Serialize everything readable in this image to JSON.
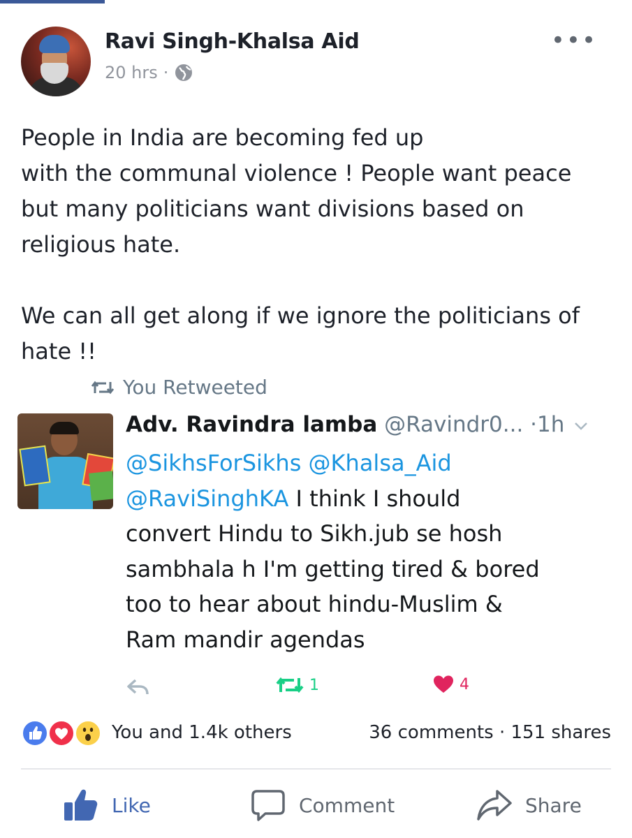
{
  "post": {
    "author": "Ravi Singh-Khalsa Aid",
    "time": "20 hrs",
    "separator": "·",
    "more_label": "•••",
    "text_lines": [
      "People in India are becoming fed up",
      "with the communal violence ! People want peace",
      "but many politicians want divisions based on",
      "religious hate."
    ],
    "text_lines_2": [
      "We can all get along if we ignore the politicians of",
      "hate !!"
    ]
  },
  "retweet": {
    "label": "You Retweeted",
    "name": "Adv. Ravindra lamba",
    "handle": "@Ravindr0...",
    "time": "·1h",
    "mentions": [
      "@SikhsForSikhs",
      "@Khalsa_Aid",
      "@RaviSinghKA"
    ],
    "text_after_mentions": "I think I should",
    "text_lines": [
      "convert Hindu to Sikh.jub se hosh",
      "sambhala h I'm getting tired & bored",
      "too to hear about hindu-Muslim &",
      "Ram mandir agendas"
    ],
    "retweet_count": "1",
    "like_count": "4",
    "colors": {
      "retweet": "#19cf86",
      "like": "#e0245e",
      "link": "#1b95e0"
    }
  },
  "reactions": {
    "summary": "You and 1.4k others",
    "comments": "36 comments",
    "dot": "·",
    "shares": "151 shares",
    "icons": [
      "like-icon",
      "love-icon",
      "wow-icon"
    ]
  },
  "actions": {
    "like": "Like",
    "comment": "Comment",
    "share": "Share",
    "like_color": "#4267b2"
  }
}
